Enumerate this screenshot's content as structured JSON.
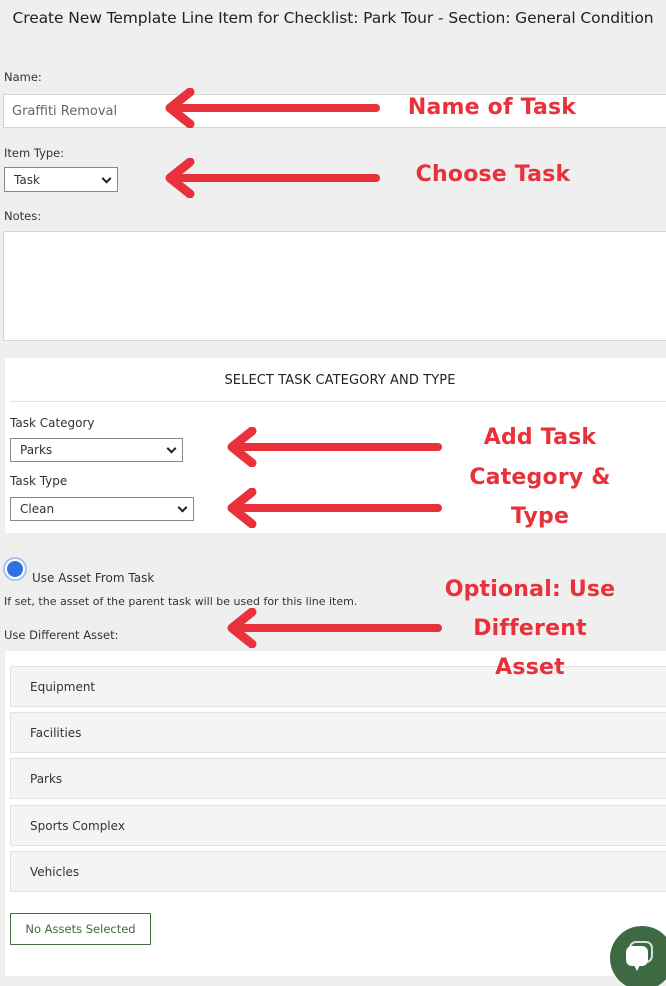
{
  "page": {
    "title": "Create New Template Line Item for Checklist: Park Tour - Section: General Condition"
  },
  "form": {
    "name_label": "Name:",
    "name_value": "Graffiti Removal",
    "item_type_label": "Item Type:",
    "item_type_value": "Task",
    "notes_label": "Notes:",
    "notes_value": ""
  },
  "task_category_panel": {
    "heading": "SELECT TASK CATEGORY AND TYPE",
    "category_label": "Task Category",
    "category_value": "Parks",
    "type_label": "Task Type",
    "type_value": "Clean"
  },
  "asset": {
    "use_asset_from_task_label": "Use Asset From Task",
    "use_asset_from_task_checked": true,
    "help_text": "If set, the asset of the parent task will be used for this line item.",
    "use_different_asset_label": "Use Different Asset:",
    "groups": [
      "Equipment",
      "Facilities",
      "Parks",
      "Sports Complex",
      "Vehicles"
    ],
    "selection_button": "No Assets Selected"
  },
  "annotations": {
    "color": "#e8313a",
    "name_of_task": "Name of Task",
    "choose_task": "Choose Task",
    "add_task_category_lines": [
      "Add Task",
      "Category &",
      "Type"
    ],
    "optional_asset_lines": [
      "Optional: Use",
      "Different",
      "Asset"
    ]
  },
  "chat": {
    "icon": "chat-bubble-icon",
    "color": "#3d6a43"
  }
}
